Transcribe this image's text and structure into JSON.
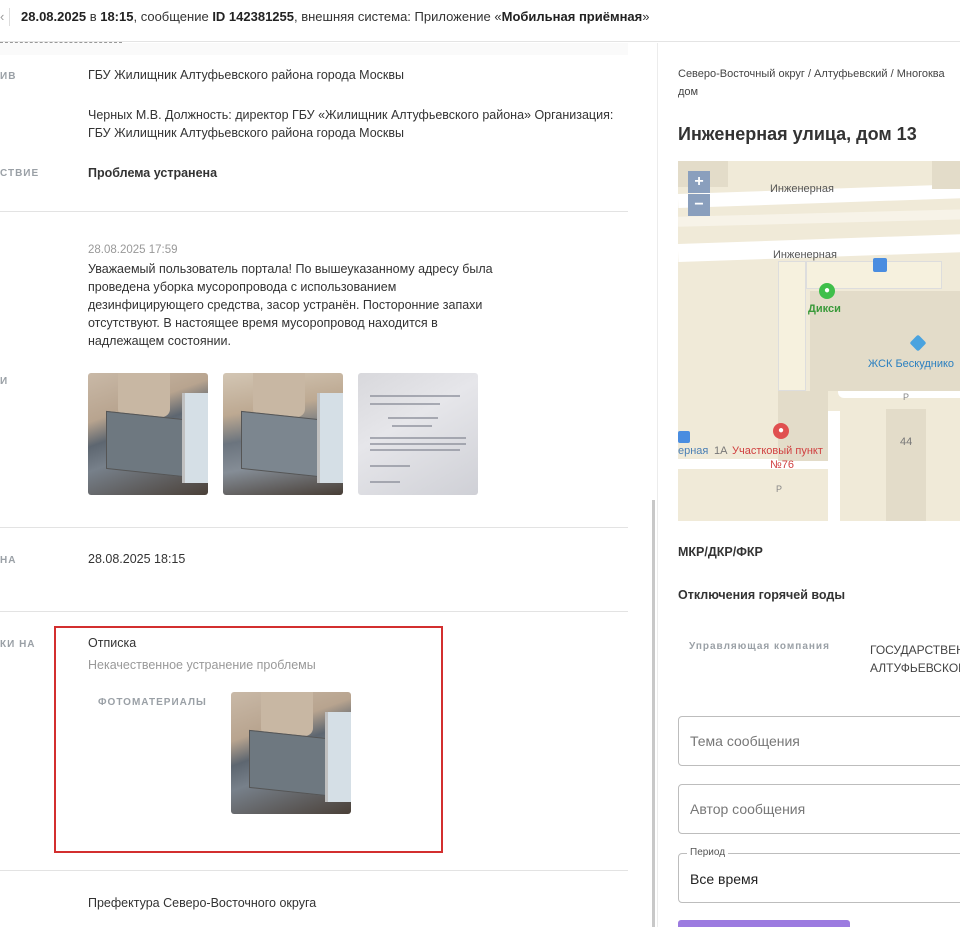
{
  "header": {
    "date": "28.08.2025",
    "in_word": " в ",
    "time": "18:15",
    "message_word": ", сообщение ",
    "message_id": "ID 142381255",
    "system_text": ", внешняя система: Приложение «",
    "app_name": "Мобильная приёмная",
    "close_quote": "»"
  },
  "left": {
    "row1": {
      "label": "ив",
      "org": "ГБУ Жилищник Алтуфьевского района города Москвы",
      "person_line1": "Черных М.В. Должность: директор ГБУ «Жилищник Алтуфьевского района» Организация:",
      "person_line2": "ГБУ Жилищник Алтуфьевского района города Москвы"
    },
    "row2": {
      "label": "ствие",
      "value": "Проблема устранена"
    },
    "answer": {
      "label": "и",
      "date": "28.08.2025 17:59",
      "text_lines": [
        "Уважаемый пользователь портала! По вышеуказанному адресу была",
        "проведена уборка мусоропровода с использованием",
        "дезинфицирующего средства, засор устранён. Посторонние запахи",
        "отсутствуют. В настоящее время мусоропровод находится в",
        "надлежащем состоянии."
      ]
    },
    "row_date": {
      "label": "на",
      "value": "28.08.2025 18:15"
    },
    "complaint": {
      "label": "ки на",
      "title": "Отписка",
      "subtitle": "Некачественное устранение проблемы",
      "photo_label": "Фотоматериалы"
    },
    "last_row": {
      "value": "Префектура Северо-Восточного округа"
    }
  },
  "right": {
    "breadcrumb_line1": "Северо-Восточный округ / Алтуфьевский / Многоква",
    "breadcrumb_line2": "дом",
    "address": "Инженерная улица, дом 13",
    "map": {
      "zoom_in": "+",
      "zoom_out": "−",
      "street1": "Инженерная",
      "street2": "Инженерная",
      "shop": "Дикси",
      "hoa": "ЖСК Бескуднико",
      "police_line1": "Участковый пункт",
      "police_line2": "№76",
      "house_44": "44",
      "bottom_street": "ерная",
      "house_1a": "1А",
      "parking": "P"
    },
    "mkr": "МКР/ДКР/ФКР",
    "hot_water": "Отключения горячей воды",
    "mgmt_label": "Управляющая компания",
    "mgmt_value_line1": "ГОСУДАРСТВЕН",
    "mgmt_value_line2": "АЛТУФЬЕВСКОГ",
    "topic_placeholder": "Тема сообщения",
    "author_placeholder": "Автор сообщения",
    "period_legend": "Период",
    "period_value": "Все время"
  }
}
